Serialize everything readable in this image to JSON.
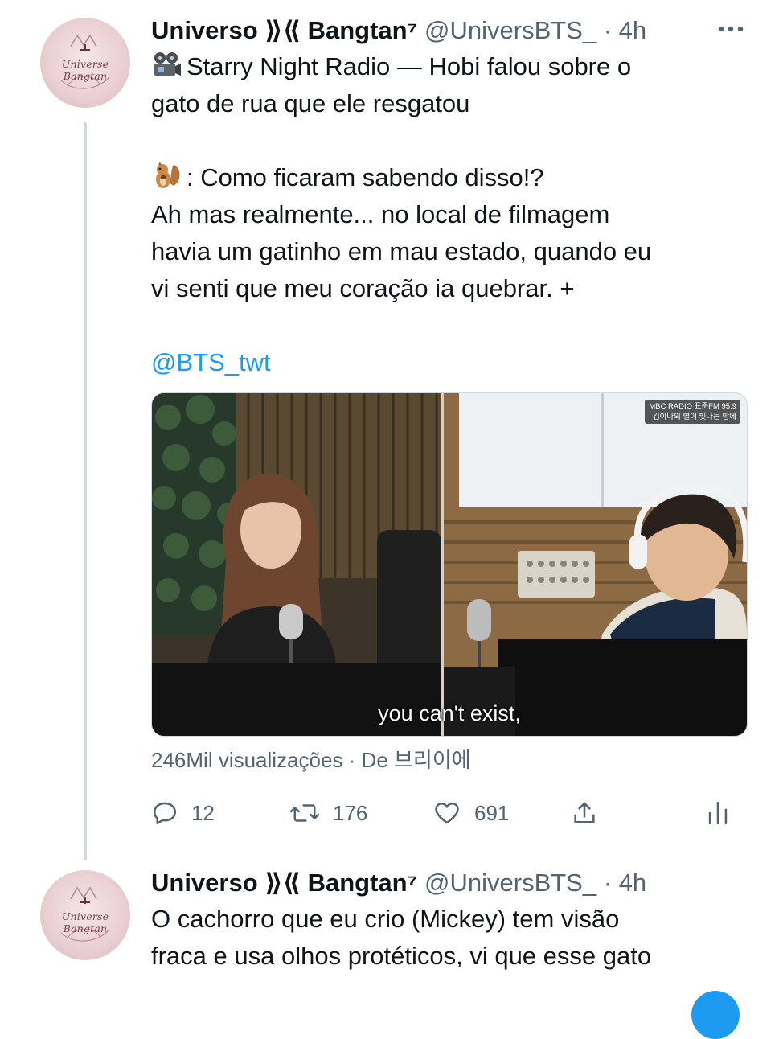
{
  "tweets": [
    {
      "author": {
        "display_name": "Universo",
        "name_symbols": " ⟫⟪ ",
        "name_suffix": "Bangtan⁷",
        "handle": "@UniversBTS_",
        "separator": "·",
        "time": "4h",
        "avatar_text": "Universe Bangtan"
      },
      "text": {
        "line1": "Starry Night Radio — Hobi falou sobre o",
        "line2": "gato de rua que ele resgatou",
        "line3": ": Como ficaram sabendo disso!?",
        "line4": "Ah mas realmente... no local de filmagem",
        "line5": "havia um gatinho em mau estado, quando eu",
        "line6": "vi senti que meu coração ia quebrar. +",
        "mention": "@BTS_twt"
      },
      "icons": {
        "lead": "film-projector-icon",
        "speaker": "chipmunk-icon"
      },
      "media": {
        "subtitle": "you can't exist,",
        "watermark_line1": "MBC RADIO 표준FM 95.9",
        "watermark_line2": "김이나의 별이 빛나는 밤에"
      },
      "views": "246Mil visualizações · De 브리이에",
      "actions": {
        "replies": "12",
        "retweets": "176",
        "likes": "691"
      },
      "colors": {
        "accent": "#1d9bf0",
        "muted": "#536471",
        "text": "#0f1419",
        "thread_line": "#cfd9de"
      }
    },
    {
      "author": {
        "display_name": "Universo",
        "name_symbols": " ⟫⟪ ",
        "name_suffix": "Bangtan⁷",
        "handle": "@UniversBTS_",
        "separator": "·",
        "time": "4h",
        "avatar_text": "Universe Bangtan"
      },
      "text": {
        "line1": "O cachorro que eu crio (Mickey) tem visão",
        "line2": "fraca e usa olhos protéticos, vi que esse gato"
      }
    }
  ]
}
